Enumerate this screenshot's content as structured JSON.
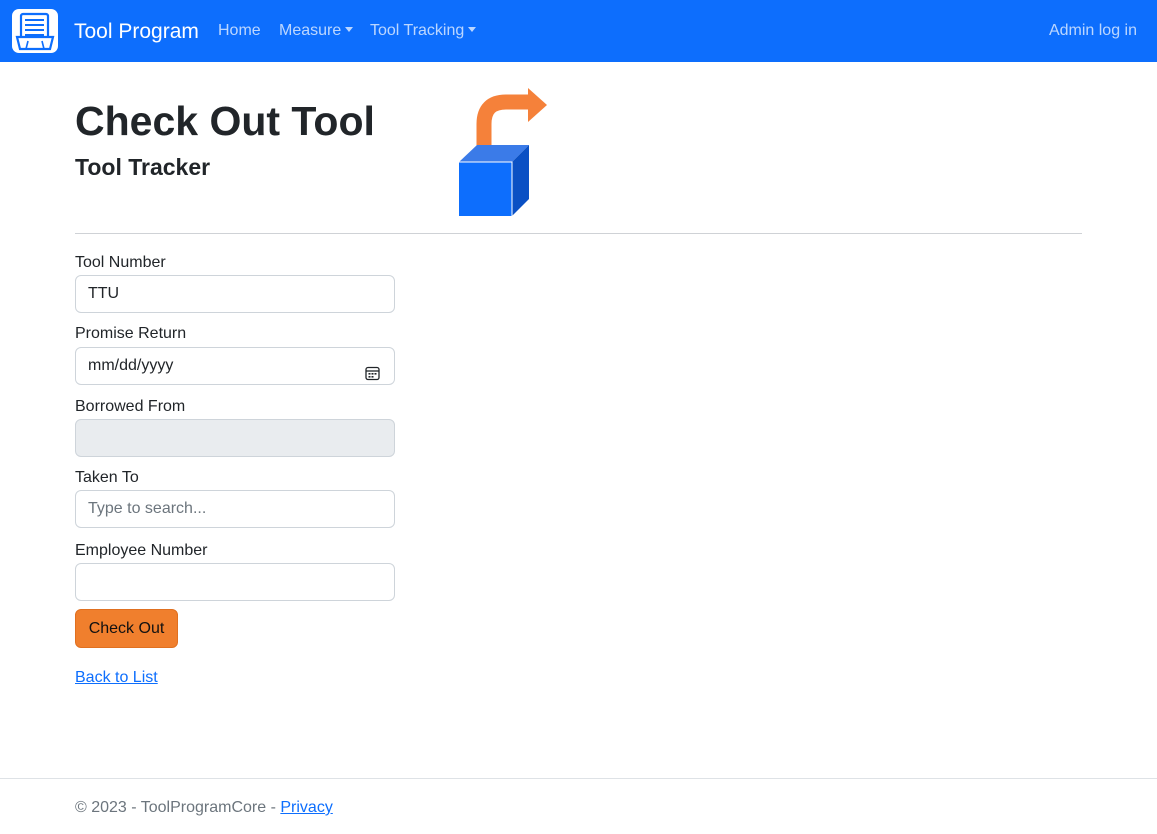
{
  "navbar": {
    "brand": "Tool Program",
    "links": {
      "home": "Home",
      "measure": "Measure",
      "tool_tracking": "Tool Tracking",
      "admin_login": "Admin log in"
    },
    "color": "#0d6efd"
  },
  "header": {
    "title": "Check Out Tool",
    "subtitle": "Tool Tracker",
    "icon": "box-with-arrow-out-icon"
  },
  "form": {
    "tool_number": {
      "label": "Tool Number",
      "value": "TTU"
    },
    "promise_return": {
      "label": "Promise Return",
      "placeholder": "mm/dd/yyyy"
    },
    "borrowed_from": {
      "label": "Borrowed From",
      "value": ""
    },
    "taken_to": {
      "label": "Taken To",
      "placeholder": "Type to search..."
    },
    "employee_number": {
      "label": "Employee Number",
      "value": ""
    },
    "submit_label": "Check Out",
    "submit_color": "#f07f2d"
  },
  "back_link": "Back to List",
  "footer": {
    "copyright": "© 2023 - ToolProgramCore - ",
    "privacy": "Privacy"
  }
}
